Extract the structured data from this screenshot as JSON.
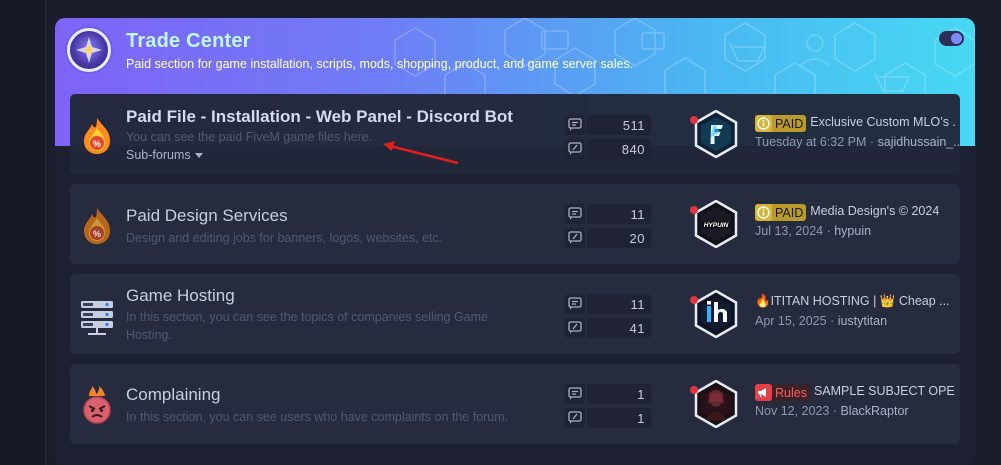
{
  "category": {
    "title": "Trade Center",
    "description": "Paid section for game installation, scripts, mods, shopping, product, and game server sales."
  },
  "forums": [
    {
      "title": "Paid File - Installation - Web Panel - Discord Bot",
      "description": "You can see the paid FiveM game files here.",
      "subforums_label": "Sub-forums",
      "threads": "511",
      "messages": "840",
      "last_post": {
        "prefix": "PAID",
        "title": "Exclusive Custom MLO’s ...",
        "date": "Tuesday at 6:32 PM",
        "user": "sajidhussain_..."
      }
    },
    {
      "title": "Paid Design Services",
      "description": "Design and editing jobs for banners, logos, websites, etc.",
      "threads": "11",
      "messages": "20",
      "last_post": {
        "prefix": "PAID",
        "title": "Media Design's © 2024",
        "date": "Jul 13, 2024",
        "user": "hypuin"
      }
    },
    {
      "title": "Game Hosting",
      "description": "In this section, you can see the topics of companies selling Game Hosting.",
      "threads": "11",
      "messages": "41",
      "last_post": {
        "prefix": "",
        "title": "🔥ITITAN HOSTING | 👑 Cheap ...",
        "date": "Apr 15, 2025",
        "user": "iustytitan"
      }
    },
    {
      "title": "Complaining",
      "description": "In this section, you can see users who have complaints on the forum.",
      "threads": "1",
      "messages": "1",
      "last_post": {
        "prefix": "Rules",
        "title": "SAMPLE SUBJECT OPENING",
        "date": "Nov 12, 2023",
        "user": "BlackRaptor"
      }
    }
  ],
  "separator": " · ",
  "colors": {
    "accent_purple": "#7f63f7",
    "accent_cyan": "#47d8f3",
    "paid_prefix": "#b99a2c",
    "rules_prefix": "#e53f47",
    "annotation_arrow": "#e0201b"
  },
  "icons": [
    "forum-category-icon",
    "fire-percent-icon",
    "server-rack-icon",
    "angry-face-icon",
    "threads-icon",
    "messages-icon",
    "toggle-icon"
  ]
}
